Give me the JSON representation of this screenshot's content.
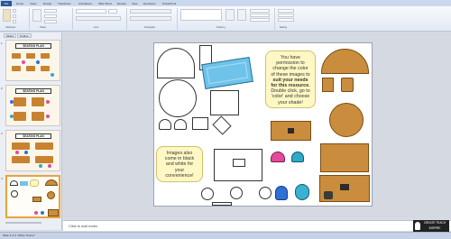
{
  "ribbon": {
    "tabs": [
      "File",
      "Home",
      "Insert",
      "Design",
      "Transitions",
      "Animations",
      "Slide Show",
      "Review",
      "View",
      "Developer",
      "PowerPoint"
    ],
    "groups": [
      "Clipboard",
      "Slides",
      "Font",
      "Paragraph",
      "Drawing",
      "Editing"
    ]
  },
  "left_pane": {
    "tabs": [
      "Slides",
      "Outline"
    ],
    "slides": [
      {
        "num": "1",
        "title": "SEATING PLAN"
      },
      {
        "num": "2",
        "title": "SEATING PLAN"
      },
      {
        "num": "3",
        "title": "SEATING PLAN"
      },
      {
        "num": "4",
        "title": ""
      }
    ]
  },
  "slide": {
    "bubble_right": "You have permission to change the color of these images to suit your needs for this resource. Double click, go to 'color' and choose your shade!",
    "bubble_right_lines": [
      "You have",
      "permission to",
      "change the color",
      "of these images to",
      "suit your needs",
      "for this resource.",
      "Double click, go to",
      "'color' and choose",
      "your shade!"
    ],
    "bubble_left_lines": [
      "Images also",
      "come in black",
      "and white for",
      "your",
      "convenience!"
    ]
  },
  "notes": {
    "placeholder": "Click to add notes"
  },
  "status": {
    "text": "Slide 4 of 4   \"Office Theme\""
  },
  "watermark": {
    "text": "CREATE TEACH INSPIRE"
  },
  "colors": {
    "accent": "#2b579a",
    "wood": "#c98d3d",
    "bubble": "#fff8c4",
    "selection": "#e8a33d",
    "chair_pink": "#e24a9b",
    "chair_blue": "#2f6fd6",
    "chair_teal": "#2fa9c9",
    "rug_blue": "#6fc3ea"
  }
}
